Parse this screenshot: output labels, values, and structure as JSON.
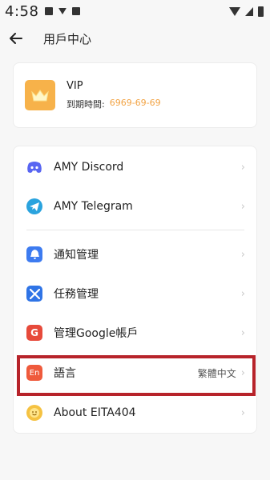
{
  "status_bar": {
    "time": "4:58",
    "left_icons": [
      "image-icon",
      "download-icon",
      "app-a-icon"
    ],
    "right_icons": [
      "wifi-icon",
      "signal-icon",
      "battery-icon"
    ]
  },
  "app_bar": {
    "back_icon": "arrow-left-icon",
    "title": "用戶中心"
  },
  "vip": {
    "title": "VIP",
    "expire_label": "到期時間:",
    "expire_date": "6969-69-69",
    "icon": "crown-icon"
  },
  "menu": {
    "items": [
      {
        "label": "AMY Discord",
        "icon": "discord-icon",
        "color": "#5865f2"
      },
      {
        "label": "AMY Telegram",
        "icon": "telegram-icon",
        "color": "#2aa3de"
      },
      {
        "label": "通知管理",
        "icon": "bell-icon",
        "color": "#3d7bf0"
      },
      {
        "label": "任務管理",
        "icon": "tools-icon",
        "color": "#2f74e6"
      },
      {
        "label": "管理Google帳戶",
        "icon": "google-icon",
        "color": "#e74a3b",
        "glyph": "G"
      },
      {
        "label": "語言",
        "icon": "language-icon",
        "color": "#ef5a3c",
        "glyph": "En",
        "value": "繁體中文"
      },
      {
        "label": "About EITA404",
        "icon": "about-smiley-icon",
        "color": "#f5c242"
      }
    ],
    "chevron": "›"
  },
  "colors": {
    "accent_date": "#f2a344",
    "crown_bg": "#f7b24a",
    "highlight_border": "#b7232a"
  }
}
